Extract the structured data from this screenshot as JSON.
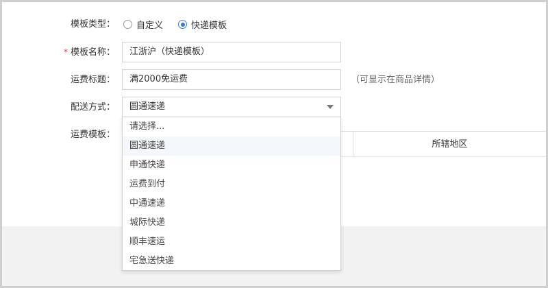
{
  "form": {
    "template_type": {
      "label": "模板类型：",
      "options": [
        "自定义",
        "快递模板"
      ],
      "selected_index": 1
    },
    "template_name": {
      "required_mark": "*",
      "label": "模板名称：",
      "value": "江浙沪（快递模板）"
    },
    "shipping_title": {
      "label": "运费标题：",
      "value": "满2000免运费",
      "hint": "（可显示在商品详情）"
    },
    "delivery_method": {
      "label": "配送方式：",
      "value": "圆通速递",
      "options": [
        "请选择...",
        "圆通速递",
        "申通快递",
        "运费到付",
        "中通速递",
        "城际快递",
        "顺丰速运",
        "宅急送快递"
      ],
      "highlighted_index": 1
    },
    "shipping_template": {
      "label": "运费模板：",
      "region_column": "所辖地区"
    }
  },
  "colors": {
    "accent": "#3a7bd5",
    "required": "#e4393c",
    "border": "#d4d4d4"
  }
}
